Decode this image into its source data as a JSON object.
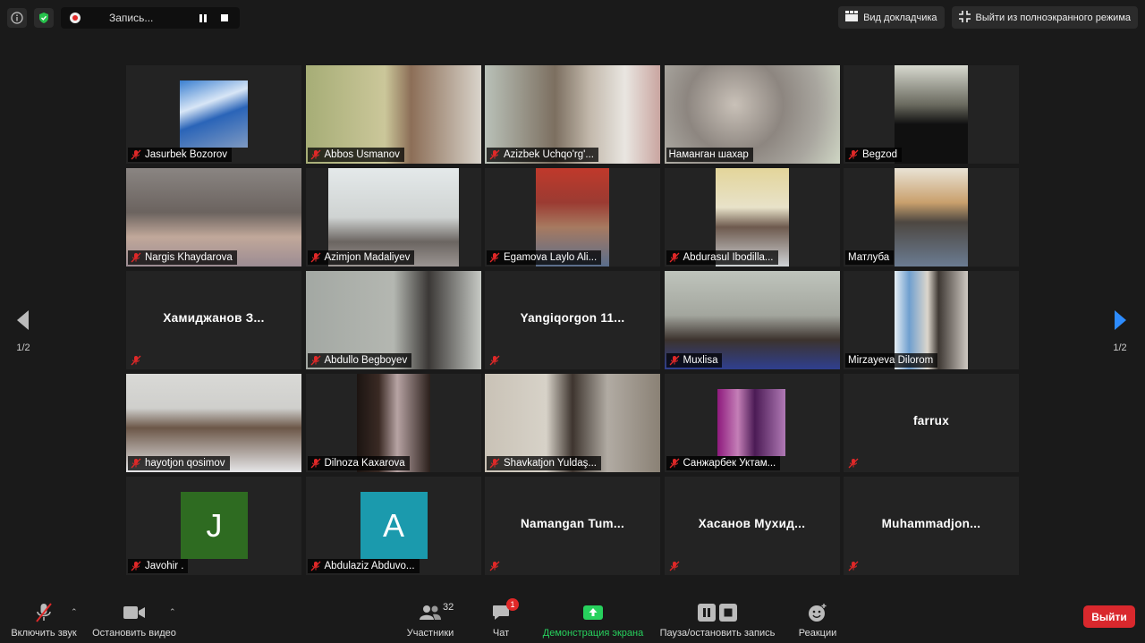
{
  "top_bar": {
    "recording_label": "Запись...",
    "speaker_view": "Вид докладчика",
    "exit_fullscreen": "Выйти из полноэкранного режима"
  },
  "pagination": {
    "left": "1/2",
    "right": "1/2"
  },
  "participants": [
    {
      "name": "Jasurbek Bozorov",
      "muted": true
    },
    {
      "name": "Abbos Usmanov",
      "muted": true
    },
    {
      "name": "Azizbek Uchqo'rg'...",
      "muted": true
    },
    {
      "name": "Наманган шахар",
      "muted": false,
      "active": true
    },
    {
      "name": "Begzod",
      "muted": true
    },
    {
      "name": "Nargis Khaydarova",
      "muted": true
    },
    {
      "name": "Azimjon Madaliyev",
      "muted": true
    },
    {
      "name": "Egamova Laylo Ali...",
      "muted": true
    },
    {
      "name": "Abdurasul Ibodilla...",
      "muted": true
    },
    {
      "name": "Матлуба",
      "muted": false
    },
    {
      "name": "Хамиджанов З...",
      "muted": true
    },
    {
      "name": "Abdullo Begboyev",
      "muted": true
    },
    {
      "name": "Yangiqorgon 11...",
      "muted": true
    },
    {
      "name": "Muxlisa",
      "muted": true
    },
    {
      "name": "Mirzayeva Dilorom",
      "muted": false
    },
    {
      "name": "hayotjon qosimov",
      "muted": true
    },
    {
      "name": "Dilnoza Kaxarova",
      "muted": true
    },
    {
      "name": "Shavkatjon Yuldaş...",
      "muted": true
    },
    {
      "name": "Санжарбек Уктам...",
      "muted": true
    },
    {
      "name": "farrux",
      "muted": true
    },
    {
      "name": "Javohir .",
      "muted": true,
      "avatar_letter": "J"
    },
    {
      "name": "Abdulaziz Abduvo...",
      "muted": true,
      "avatar_letter": "A"
    },
    {
      "name": "Namangan Tum...",
      "muted": true
    },
    {
      "name": "Хасанов Мухид...",
      "muted": true
    },
    {
      "name": "Muhammadjon...",
      "muted": true
    }
  ],
  "toolbar": {
    "unmute": "Включить звук",
    "start_video": "Остановить видео",
    "participants": "Участники",
    "participants_count": "32",
    "chat": "Чат",
    "chat_badge": "1",
    "share_screen": "Демонстрация экрана",
    "pause_recording": "Пауза/остановить запись",
    "reactions": "Реакции",
    "leave": "Выйти"
  },
  "colors": {
    "active_speaker": "#d9e86b",
    "leave_button": "#d9282d",
    "share_green": "#27d15d",
    "avatar_j": "#2e6b21",
    "avatar_a": "#1b9aad",
    "page_arrow_right": "#2d8cff"
  }
}
